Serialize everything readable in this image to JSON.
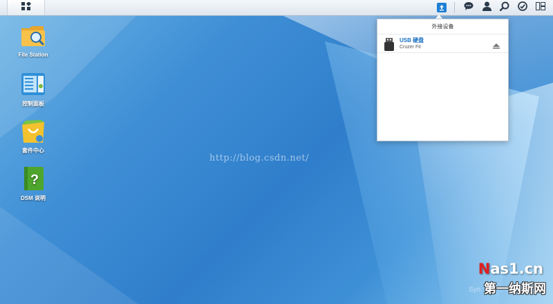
{
  "desktop": {
    "icons": [
      {
        "label": "File Station",
        "icon": "file-station-icon"
      },
      {
        "label": "控制面板",
        "icon": "control-panel-icon"
      },
      {
        "label": "套件中心",
        "icon": "package-center-icon"
      },
      {
        "label": "DSM 说明",
        "icon": "dsm-help-icon"
      }
    ]
  },
  "taskbar": {
    "main_menu_icon": "grid-menu-icon",
    "tray": [
      "external-device-icon",
      "notification-icon",
      "user-icon",
      "search-icon",
      "widget-icon",
      "desktop-layout-icon"
    ]
  },
  "popup": {
    "title": "外接设备",
    "devices": [
      {
        "name": "USB 硬盘",
        "model": "Cruzer Fit",
        "action": "eject-icon"
      }
    ]
  },
  "watermark": {
    "url": "http://blog.csdn.net/",
    "brand_top_accent": "N",
    "brand_top_rest": "as1.cn",
    "brand_bottom": "第一纳斯网",
    "faint_text": "Syn"
  },
  "colors": {
    "accent": "#1f7fd6",
    "desktop_bg": "#2f7ecb",
    "brand_red": "#e02020"
  }
}
